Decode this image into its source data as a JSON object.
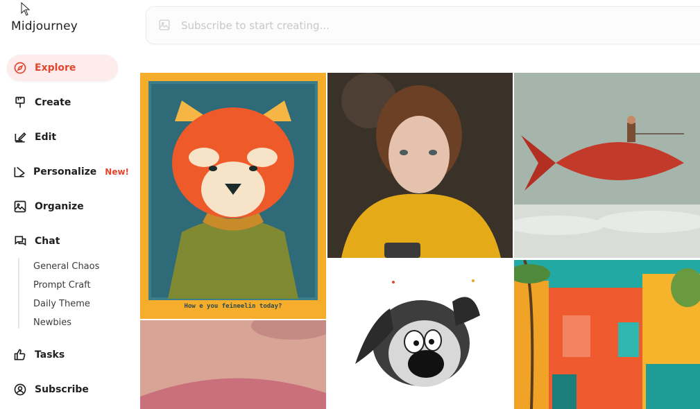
{
  "app": {
    "name": "Midjourney"
  },
  "sidebar": {
    "items": [
      {
        "label": "Explore",
        "icon": "compass-icon",
        "active": true
      },
      {
        "label": "Create",
        "icon": "brush-icon"
      },
      {
        "label": "Edit",
        "icon": "edit-icon"
      },
      {
        "label": "Personalize",
        "icon": "personalize-icon",
        "badge": "New!"
      },
      {
        "label": "Organize",
        "icon": "image-icon"
      },
      {
        "label": "Chat",
        "icon": "chat-icon"
      },
      {
        "label": "Tasks",
        "icon": "thumbs-up-icon"
      },
      {
        "label": "Subscribe",
        "icon": "user-circle-icon"
      }
    ],
    "chat_channels": [
      "General Chaos",
      "Prompt Craft",
      "Daily Theme",
      "Newbies"
    ]
  },
  "search": {
    "placeholder": "Subscribe to start creating..."
  },
  "gallery": {
    "tiles": [
      {
        "subject": "red panda in sweater illustration",
        "caption": "How e you feineelin today?"
      },
      {
        "subject": "woman in yellow sweater"
      },
      {
        "subject": "person riding red fish in sky"
      },
      {
        "subject": "close-up of lips"
      },
      {
        "subject": "cartoon dog sketch"
      },
      {
        "subject": "colorful village buildings"
      }
    ]
  },
  "colors": {
    "accent": "#e2452e",
    "active_bg": "#fdeceb"
  }
}
